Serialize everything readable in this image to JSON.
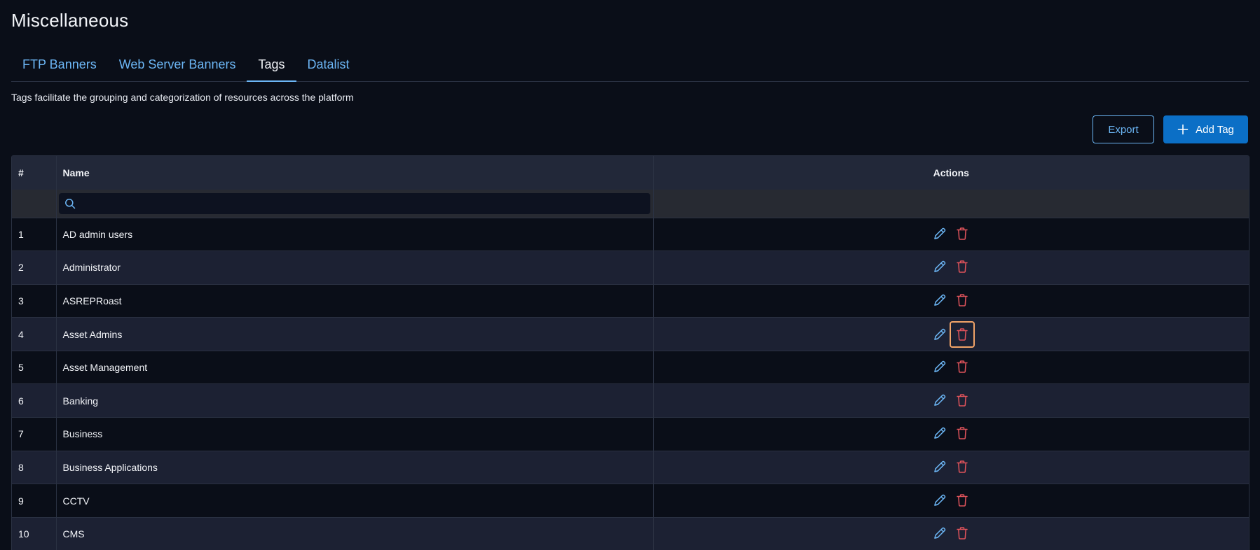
{
  "page": {
    "title": "Miscellaneous",
    "description": "Tags facilitate the grouping and categorization of resources across the platform"
  },
  "tabs": [
    {
      "label": "FTP Banners",
      "active": false
    },
    {
      "label": "Web Server Banners",
      "active": false
    },
    {
      "label": "Tags",
      "active": true
    },
    {
      "label": "Datalist",
      "active": false
    }
  ],
  "toolbar": {
    "export_label": "Export",
    "add_label": "Add Tag"
  },
  "table": {
    "columns": {
      "num": "#",
      "name": "Name",
      "actions": "Actions"
    },
    "search": {
      "value": "",
      "placeholder": ""
    },
    "rows": [
      {
        "num": "1",
        "name": "AD admin users"
      },
      {
        "num": "2",
        "name": "Administrator"
      },
      {
        "num": "3",
        "name": "ASREPRoast"
      },
      {
        "num": "4",
        "name": "Asset Admins"
      },
      {
        "num": "5",
        "name": "Asset Management"
      },
      {
        "num": "6",
        "name": "Banking"
      },
      {
        "num": "7",
        "name": "Business"
      },
      {
        "num": "8",
        "name": "Business Applications"
      },
      {
        "num": "9",
        "name": "CCTV"
      },
      {
        "num": "10",
        "name": "CMS"
      }
    ],
    "row_actions": {
      "edit_icon": "pencil-icon",
      "delete_icon": "trash-icon",
      "focused_delete_row": 4
    }
  },
  "colors": {
    "background": "#0a0e18",
    "accent": "#6cb6f5",
    "primary_button": "#0b6fc6",
    "delete": "#e0535b",
    "focus_ring": "#f2a468"
  }
}
